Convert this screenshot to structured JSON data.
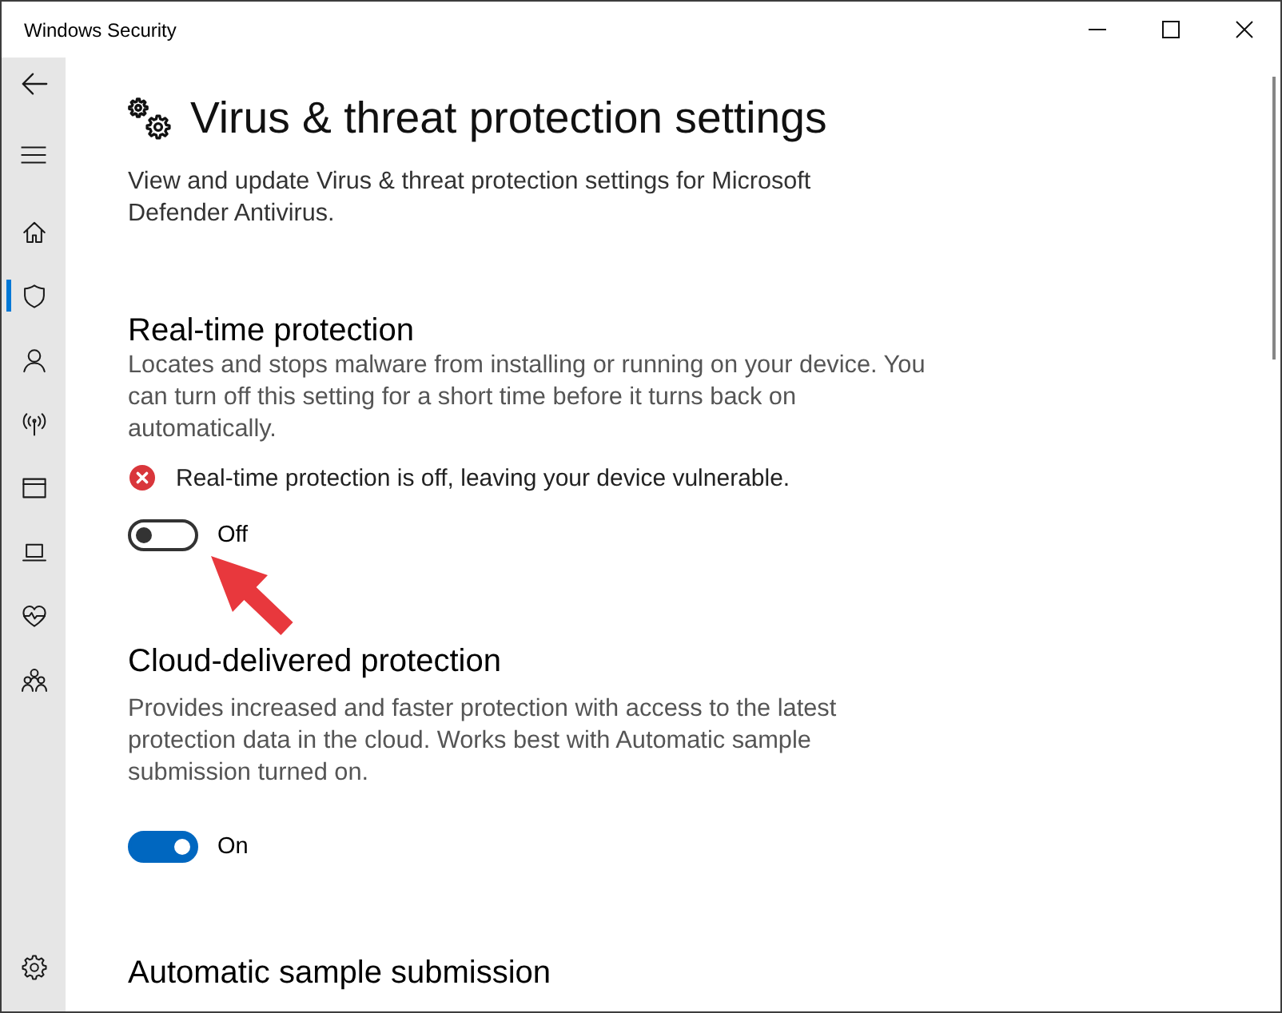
{
  "window": {
    "title": "Windows Security"
  },
  "sidebar": {
    "nav_items": [
      {
        "kind": "home",
        "selected": false
      },
      {
        "kind": "virus_protection",
        "selected": true
      },
      {
        "kind": "account",
        "selected": false
      },
      {
        "kind": "firewall",
        "selected": false
      },
      {
        "kind": "app_control",
        "selected": false
      },
      {
        "kind": "device_security",
        "selected": false
      },
      {
        "kind": "device_health",
        "selected": false
      },
      {
        "kind": "family",
        "selected": false
      }
    ],
    "footer_items": [
      {
        "kind": "settings",
        "selected": false
      }
    ]
  },
  "page": {
    "title": "Virus & threat protection settings",
    "description": "View and update Virus & threat protection settings for Microsoft Defender Antivirus.",
    "sections": [
      {
        "heading": "Real-time protection",
        "description": "Locates and stops malware from installing or running on your device. You can turn off this setting for a short time before it turns back on automatically.",
        "alert": {
          "text": "Real-time protection is off, leaving your device vulnerable."
        },
        "toggle": {
          "on": false,
          "label": "Off",
          "arrow_callout": true
        }
      },
      {
        "heading": "Cloud-delivered protection",
        "description": "Provides increased and faster protection with access to the latest protection data in the cloud. Works best with Automatic sample submission turned on.",
        "toggle": {
          "on": true,
          "label": "On"
        }
      },
      {
        "heading": "Automatic sample submission"
      }
    ]
  }
}
